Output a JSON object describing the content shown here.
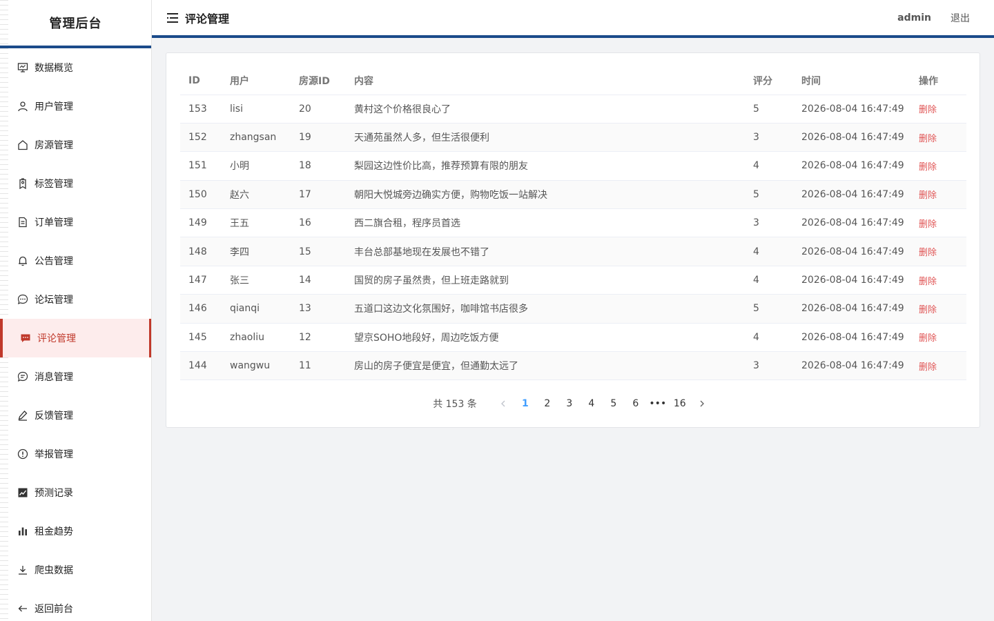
{
  "sidebar": {
    "title": "管理后台",
    "items": [
      {
        "label": "数据概览",
        "icon": "dashboard-icon"
      },
      {
        "label": "用户管理",
        "icon": "user-icon"
      },
      {
        "label": "房源管理",
        "icon": "house-icon"
      },
      {
        "label": "标签管理",
        "icon": "tag-icon"
      },
      {
        "label": "订单管理",
        "icon": "document-icon"
      },
      {
        "label": "公告管理",
        "icon": "bell-icon"
      },
      {
        "label": "论坛管理",
        "icon": "chat-dots-icon"
      },
      {
        "label": "评论管理",
        "icon": "comment-icon",
        "active": true
      },
      {
        "label": "消息管理",
        "icon": "message-icon"
      },
      {
        "label": "反馈管理",
        "icon": "edit-pen-icon"
      },
      {
        "label": "举报管理",
        "icon": "warning-icon"
      },
      {
        "label": "预测记录",
        "icon": "trend-chart-icon"
      },
      {
        "label": "租金趋势",
        "icon": "bar-chart-icon"
      },
      {
        "label": "爬虫数据",
        "icon": "download-icon"
      },
      {
        "label": "返回前台",
        "icon": "back-arrow-icon"
      }
    ]
  },
  "header": {
    "title": "评论管理",
    "user": "admin",
    "logout": "退出"
  },
  "table": {
    "columns": [
      "ID",
      "用户",
      "房源ID",
      "内容",
      "评分",
      "时间",
      "操作"
    ],
    "delete_label": "删除",
    "rows": [
      {
        "id": "153",
        "user": "lisi",
        "house_id": "20",
        "content": "黄村这个价格很良心了",
        "score": "5",
        "time": "2026-08-04 16:47:49"
      },
      {
        "id": "152",
        "user": "zhangsan",
        "house_id": "19",
        "content": "天通苑虽然人多，但生活很便利",
        "score": "3",
        "time": "2026-08-04 16:47:49"
      },
      {
        "id": "151",
        "user": "小明",
        "house_id": "18",
        "content": "梨园这边性价比高，推荐预算有限的朋友",
        "score": "4",
        "time": "2026-08-04 16:47:49"
      },
      {
        "id": "150",
        "user": "赵六",
        "house_id": "17",
        "content": "朝阳大悦城旁边确实方便，购物吃饭一站解决",
        "score": "5",
        "time": "2026-08-04 16:47:49"
      },
      {
        "id": "149",
        "user": "王五",
        "house_id": "16",
        "content": "西二旗合租，程序员首选",
        "score": "3",
        "time": "2026-08-04 16:47:49"
      },
      {
        "id": "148",
        "user": "李四",
        "house_id": "15",
        "content": "丰台总部基地现在发展也不错了",
        "score": "4",
        "time": "2026-08-04 16:47:49"
      },
      {
        "id": "147",
        "user": "张三",
        "house_id": "14",
        "content": "国贸的房子虽然贵，但上班走路就到",
        "score": "4",
        "time": "2026-08-04 16:47:49"
      },
      {
        "id": "146",
        "user": "qianqi",
        "house_id": "13",
        "content": "五道口这边文化氛围好，咖啡馆书店很多",
        "score": "5",
        "time": "2026-08-04 16:47:49"
      },
      {
        "id": "145",
        "user": "zhaoliu",
        "house_id": "12",
        "content": "望京SOHO地段好，周边吃饭方便",
        "score": "4",
        "time": "2026-08-04 16:47:49"
      },
      {
        "id": "144",
        "user": "wangwu",
        "house_id": "11",
        "content": "房山的房子便宜是便宜，但通勤太远了",
        "score": "3",
        "time": "2026-08-04 16:47:49"
      }
    ]
  },
  "pagination": {
    "total_text": "共 153 条",
    "pages": [
      "1",
      "2",
      "3",
      "4",
      "5",
      "6",
      "•••",
      "16"
    ],
    "current": "1"
  },
  "colors": {
    "accent": "#1b4b8a",
    "active": "#c0392b",
    "delete": "#e05555",
    "page_active": "#409eff"
  }
}
